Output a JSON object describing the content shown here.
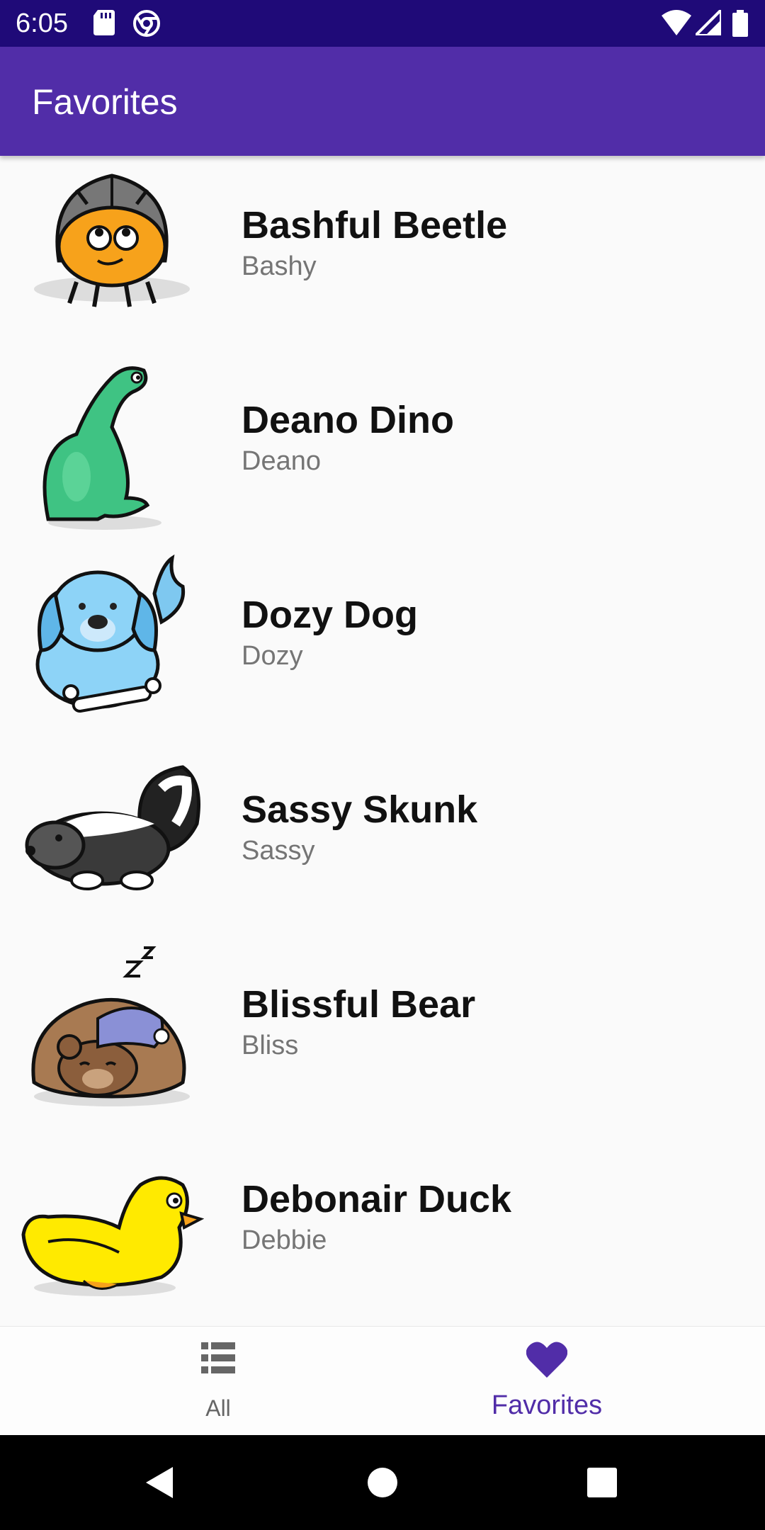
{
  "status_bar": {
    "time": "6:05",
    "icons": [
      "sd-card-icon",
      "chrome-icon",
      "wifi-icon",
      "signal-icon",
      "battery-icon"
    ]
  },
  "app_bar": {
    "title": "Favorites"
  },
  "pets": [
    {
      "name": "Bashful Beetle",
      "nickname": "Bashy",
      "icon": "beetle-icon"
    },
    {
      "name": "Deano Dino",
      "nickname": "Deano",
      "icon": "dino-icon"
    },
    {
      "name": "Dozy Dog",
      "nickname": "Dozy",
      "icon": "dog-icon"
    },
    {
      "name": "Sassy Skunk",
      "nickname": "Sassy",
      "icon": "skunk-icon"
    },
    {
      "name": "Blissful Bear",
      "nickname": "Bliss",
      "icon": "bear-icon"
    },
    {
      "name": "Debonair Duck",
      "nickname": "Debbie",
      "icon": "duck-icon"
    }
  ],
  "bottom_nav": {
    "items": [
      {
        "label": "All",
        "icon": "list-icon",
        "selected": false
      },
      {
        "label": "Favorites",
        "icon": "heart-icon",
        "selected": true
      }
    ]
  },
  "colors": {
    "primary": "#512da8",
    "status_bar": "#1f0a78",
    "background": "#fafafa",
    "secondary_text": "#757575"
  },
  "system_nav": {
    "buttons": [
      "back-icon",
      "home-icon",
      "recents-icon"
    ]
  }
}
